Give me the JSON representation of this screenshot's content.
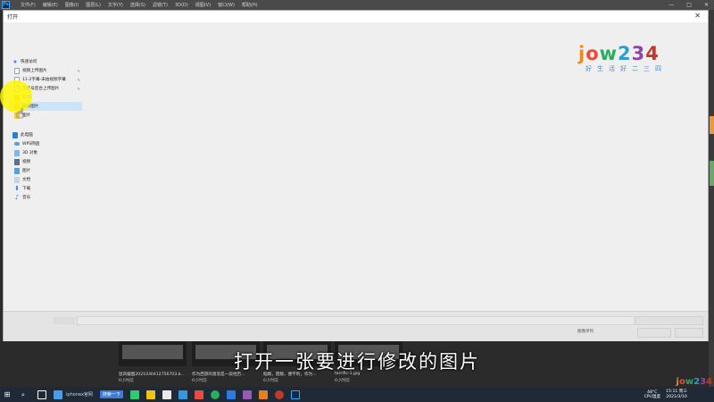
{
  "menubar": {
    "items": [
      "文件(F)",
      "编辑(E)",
      "图像(I)",
      "图层(L)",
      "文字(Y)",
      "选择(S)",
      "滤镜(T)",
      "3D(D)",
      "视图(V)",
      "窗口(W)",
      "帮助(H)"
    ]
  },
  "dialog": {
    "title": "打开",
    "close": "✕",
    "seq_label": "图像序列"
  },
  "nav": {
    "quick_access": "快速访问",
    "quick_items": [
      {
        "label": "视频上传图片",
        "icon": "document-icon",
        "pin": "📌"
      },
      {
        "label": "11-2字幕-未拍视频字幕",
        "icon": "document-icon",
        "pin": "📌"
      },
      {
        "label": "百家号后台上传图片",
        "icon": "document-icon",
        "pin": "📌"
      },
      {
        "label": "3-10",
        "icon": "folder-icon"
      },
      {
        "label": "裁屏图片",
        "icon": "folder-icon"
      },
      {
        "label": "图片",
        "icon": "folder-icon"
      }
    ],
    "this_pc": "此电脑",
    "pc_items": [
      {
        "label": "WPS网盘",
        "icon": "cloud-icon"
      },
      {
        "label": "3D 对象",
        "icon": "3d-objects-icon"
      },
      {
        "label": "视频",
        "icon": "video-icon"
      },
      {
        "label": "图片",
        "icon": "pictures-icon"
      },
      {
        "label": "文档",
        "icon": "documents-icon"
      },
      {
        "label": "下载",
        "icon": "download-icon"
      },
      {
        "label": "音乐",
        "icon": "music-icon"
      }
    ]
  },
  "logo": {
    "chars": [
      "j",
      "o",
      "w",
      "2",
      "3",
      "4"
    ],
    "sub": "好生活好二三四"
  },
  "thumbs": [
    {
      "name": "鼠风截图20210304127567​03.b...",
      "time": "6小时前"
    },
    {
      "name": "作为西游的意思是一段经历...",
      "time": "6小时前"
    },
    {
      "name": "稻稿，阻稿，便不利，作为...",
      "time": "6小时前"
    },
    {
      "name": "terrific-1.jpg",
      "time": "6小时前"
    }
  ],
  "subtitle": "打开一张要进行修改的图片",
  "taskbar": {
    "search_label": "iphonex官网",
    "btn_label": "搜索一下",
    "weather": [
      "48°C",
      "CPU温度"
    ],
    "clock": [
      "15:11 周三",
      "2021/3/10"
    ]
  },
  "colors": {
    "highlight": "#fff600",
    "accent": "#2f78d0"
  }
}
